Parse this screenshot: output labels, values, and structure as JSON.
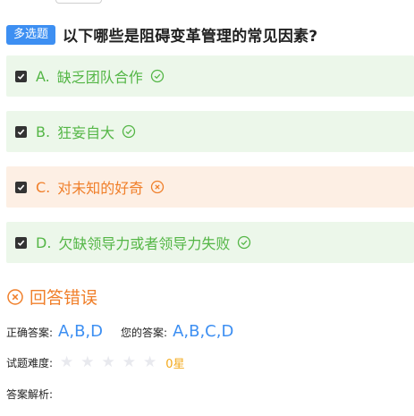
{
  "question": {
    "type_label": "多选题",
    "title": "以下哪些是阻碍变革管理的常见因素?"
  },
  "options": [
    {
      "key": "A.",
      "text": "缺乏团队合作",
      "status": "correct"
    },
    {
      "key": "B.",
      "text": "狂妄自大",
      "status": "correct"
    },
    {
      "key": "C.",
      "text": "对未知的好奇",
      "status": "wrong"
    },
    {
      "key": "D.",
      "text": "欠缺领导力或者领导力失败",
      "status": "correct"
    }
  ],
  "result": {
    "text": "回答错误",
    "icon": "x-circle-icon"
  },
  "answer": {
    "correct_label": "正确答案:",
    "correct_value": "A,B,D",
    "yours_label": "您的答案:",
    "yours_value": "A,B,C,D"
  },
  "difficulty": {
    "label": "试题难度:",
    "stars_filled": 0,
    "stars_total": 5,
    "value_text": "0星"
  },
  "analysis": {
    "label": "答案解析:"
  },
  "colors": {
    "accent_blue": "#3d8ff2",
    "correct_green": "#54b646",
    "correct_bg": "#ecf7ea",
    "wrong_orange": "#f07f2a",
    "wrong_bg": "#fdefe4",
    "star_empty": "#e8e9ee",
    "star_text": "#f3a91b"
  }
}
